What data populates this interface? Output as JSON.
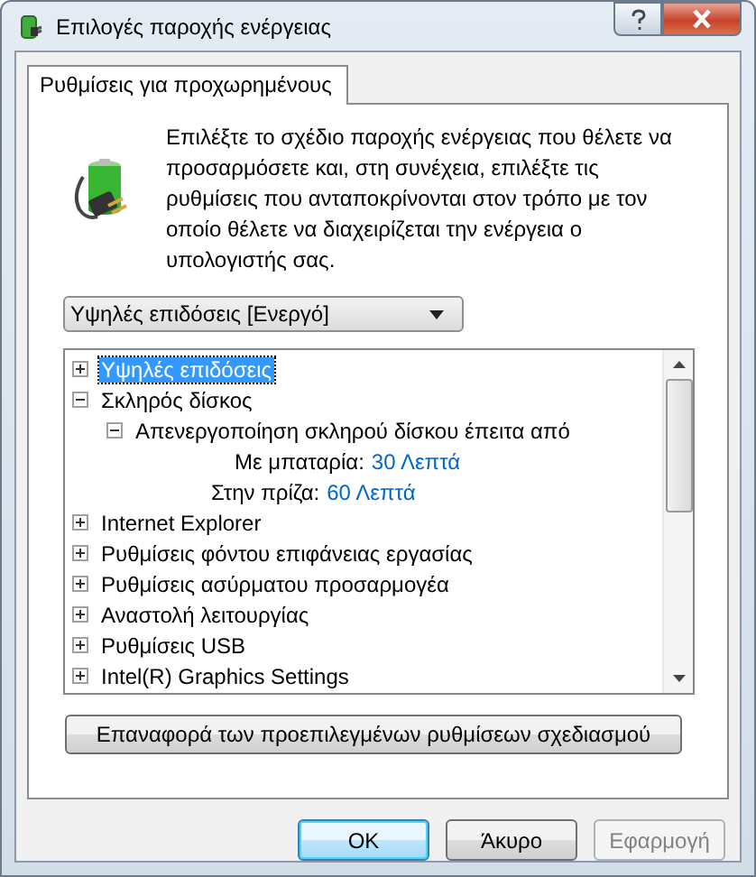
{
  "window": {
    "title": "Επιλογές παροχής ενέργειας"
  },
  "tabs": [
    {
      "label": "Ρυθμίσεις για προχωρημένους",
      "selected": true
    }
  ],
  "description": "Επιλέξτε το σχέδιο παροχής ενέργειας που θέλετε να προσαρμόσετε και, στη συνέχεια, επιλέξτε τις ρυθμίσεις που ανταποκρίνονται στον τρόπο με τον οποίο θέλετε να διαχειρίζεται την ενέργεια ο υπολογιστής σας.",
  "plan_dropdown": {
    "value": "Υψηλές επιδόσεις [Ενεργό]"
  },
  "tree": [
    {
      "kind": "group",
      "label": "Υψηλές επιδόσεις",
      "expanded": false,
      "selected": true
    },
    {
      "kind": "group",
      "label": "Σκληρός δίσκος",
      "expanded": true,
      "selected": false,
      "children": [
        {
          "kind": "group",
          "label": "Απενεργοποίηση σκληρού δίσκου έπειτα από",
          "expanded": true,
          "selected": false,
          "children": [
            {
              "kind": "setting",
              "label": "Με μπαταρία:",
              "value": "30 Λεπτά"
            },
            {
              "kind": "setting",
              "label": "Στην πρίζα:",
              "value": "60 Λεπτά"
            }
          ]
        }
      ]
    },
    {
      "kind": "group",
      "label": "Internet Explorer",
      "expanded": false,
      "selected": false
    },
    {
      "kind": "group",
      "label": "Ρυθμίσεις φόντου επιφάνειας εργασίας",
      "expanded": false,
      "selected": false
    },
    {
      "kind": "group",
      "label": "Ρυθμίσεις ασύρματου προσαρμογέα",
      "expanded": false,
      "selected": false
    },
    {
      "kind": "group",
      "label": "Αναστολή λειτουργίας",
      "expanded": false,
      "selected": false
    },
    {
      "kind": "group",
      "label": "Ρυθμίσεις USB",
      "expanded": false,
      "selected": false
    },
    {
      "kind": "group",
      "label": "Intel(R) Graphics Settings",
      "expanded": false,
      "selected": false
    }
  ],
  "restore_button": "Επαναφορά των προεπιλεγμένων ρυθμίσεων σχεδιασμού",
  "buttons": [
    {
      "label": "ΟΚ",
      "default": true,
      "disabled": false
    },
    {
      "label": "Άκυρο",
      "default": false,
      "disabled": false
    },
    {
      "label": "Εφαρμογή",
      "default": false,
      "disabled": true
    }
  ]
}
